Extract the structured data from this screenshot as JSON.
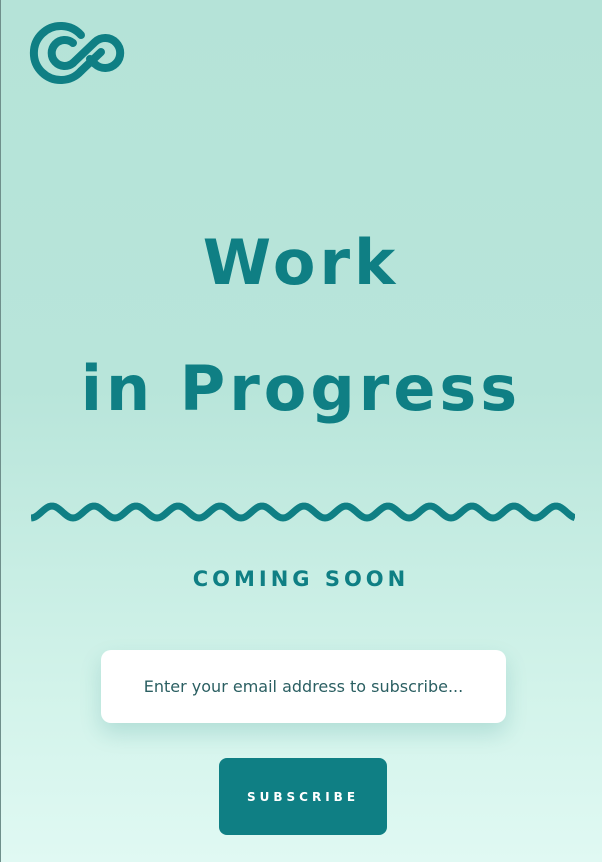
{
  "colors": {
    "accent": "#0f7f84",
    "background_top": "#b5e3d8",
    "background_bottom": "#e0f9f3",
    "input_bg": "#ffffff"
  },
  "logo": {
    "icon": "infinity-c-logo-icon"
  },
  "hero": {
    "line1": "Work",
    "line2": "in Progress",
    "divider_icon": "wave-divider"
  },
  "tagline": "COMING SOON",
  "subscribe": {
    "email_placeholder": "Enter your email address to subscribe...",
    "email_value": "",
    "button_label": "SUBSCRIBE"
  }
}
